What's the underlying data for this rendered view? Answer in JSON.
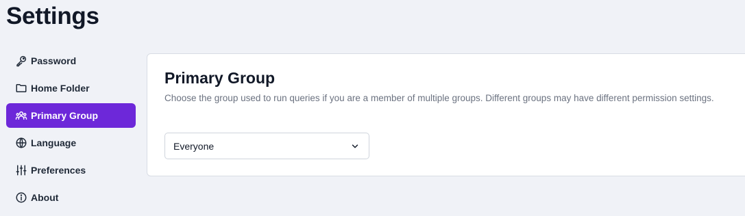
{
  "page": {
    "title": "Settings"
  },
  "sidebar": {
    "items": [
      {
        "label": "Password",
        "icon": "key-icon",
        "active": false
      },
      {
        "label": "Home Folder",
        "icon": "folder-icon",
        "active": false
      },
      {
        "label": "Primary Group",
        "icon": "users-icon",
        "active": true
      },
      {
        "label": "Language",
        "icon": "globe-icon",
        "active": false
      },
      {
        "label": "Preferences",
        "icon": "sliders-icon",
        "active": false
      },
      {
        "label": "About",
        "icon": "info-icon",
        "active": false
      }
    ]
  },
  "main": {
    "title": "Primary Group",
    "description": "Choose the group used to run queries if you are a member of multiple groups. Different groups may have different permission settings.",
    "group_select": {
      "value": "Everyone"
    }
  },
  "colors": {
    "accent": "#6d28d9",
    "background": "#f0f2f7",
    "card": "#ffffff",
    "muted_text": "#6b7280"
  }
}
